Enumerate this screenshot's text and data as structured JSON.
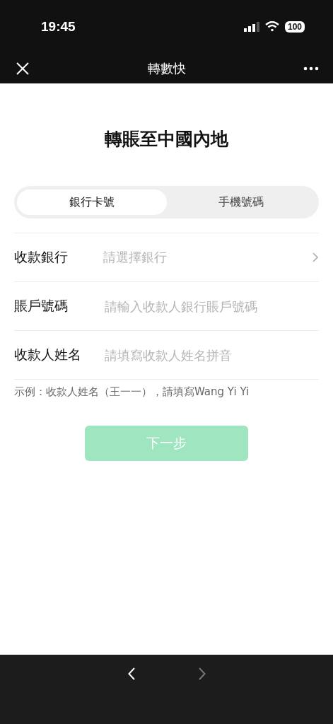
{
  "status_bar": {
    "time": "19:45",
    "battery": "100"
  },
  "nav_bar": {
    "title": "轉數快"
  },
  "heading": "轉賬至中國內地",
  "tabs": [
    {
      "label": "銀行卡號",
      "selected": true
    },
    {
      "label": "手機號碼",
      "selected": false
    }
  ],
  "fields": [
    {
      "kind": "select",
      "label": "收款銀行",
      "placeholder": "請選擇銀行"
    },
    {
      "kind": "input",
      "label": "賬戶號碼",
      "placeholder": "請輸入收款人銀行賬戶號碼"
    },
    {
      "kind": "input",
      "label": "收款人姓名",
      "placeholder": "請填寫收款人姓名拼音"
    }
  ],
  "hint": "示例：收款人姓名（王一一），請填寫Wang Yi Yi",
  "next_button": {
    "label": "下一步",
    "disabled": true
  },
  "bottom_bar": {
    "back_disabled": false,
    "forward_disabled": true
  }
}
